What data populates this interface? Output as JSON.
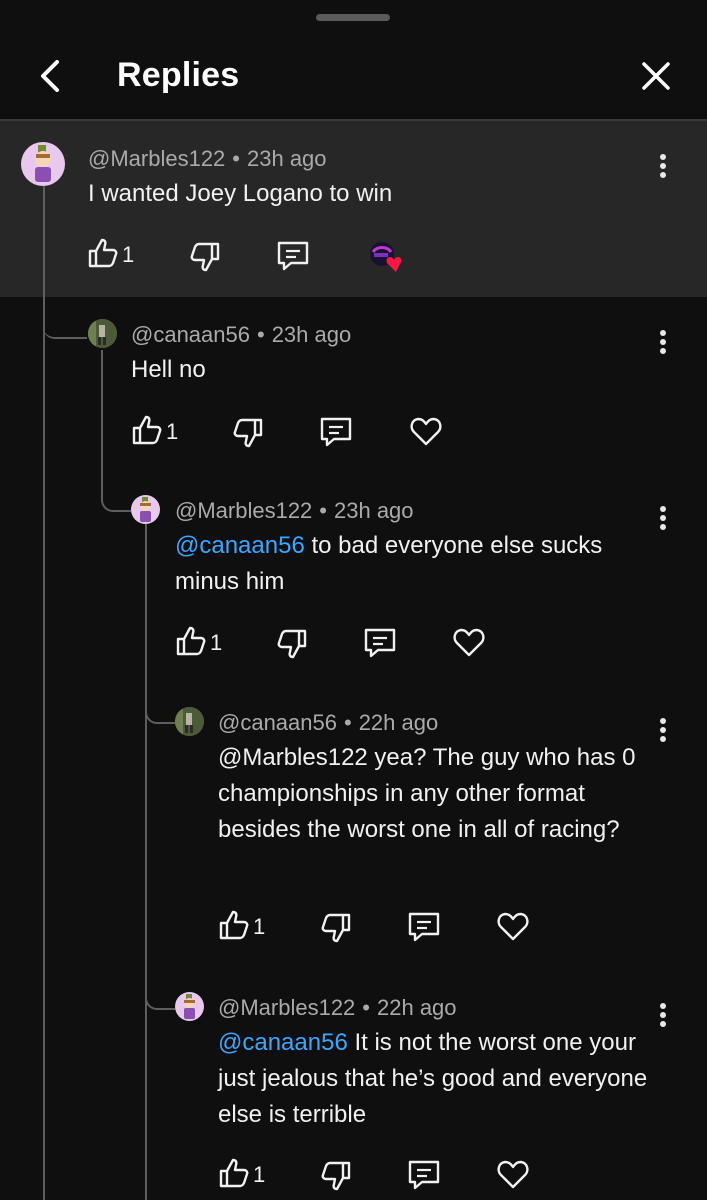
{
  "header": {
    "title": "Replies",
    "back_icon": "chevron-left-icon",
    "close_icon": "close-icon"
  },
  "comments": [
    {
      "author": "@Marbles122",
      "time": "23h ago",
      "mention": "",
      "text": "I wanted Joey Logano to win",
      "likes": "1",
      "creator_heart": true
    },
    {
      "author": "@canaan56",
      "time": "23h ago",
      "mention": "",
      "text": "Hell no",
      "likes": "1",
      "creator_heart": false
    },
    {
      "author": "@Marbles122",
      "time": "23h ago",
      "mention": "@canaan56",
      "text": " to bad everyone else sucks minus him",
      "likes": "1",
      "creator_heart": false
    },
    {
      "author": "@canaan56",
      "time": "22h ago",
      "mention": "",
      "text": "@Marbles122 yea? The guy who has 0 championships in any other format besides the worst one in all of racing?",
      "likes": "1",
      "creator_heart": false
    },
    {
      "author": "@Marbles122",
      "time": "22h ago",
      "mention": "@canaan56",
      "text": " It is not the worst one your just jealous that he’s good and everyone else is terrible",
      "likes": "1",
      "creator_heart": false
    }
  ],
  "colors": {
    "background": "#0f0f0f",
    "highlight": "#272727",
    "mention": "#3ea6ff",
    "heart_badge": "#ff1744"
  }
}
